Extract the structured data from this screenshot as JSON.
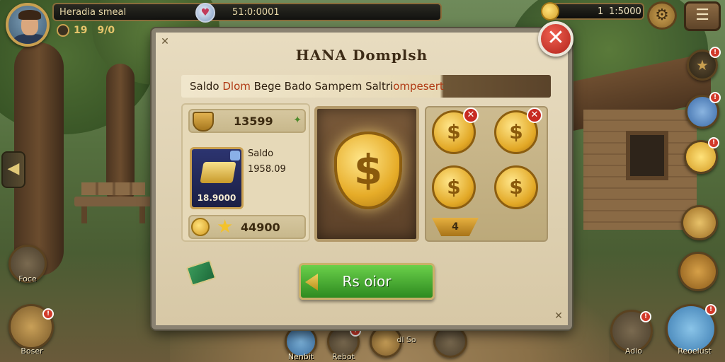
{
  "hud": {
    "player_name": "Heradia smeal",
    "top_value": "51:0:0001",
    "level": "19",
    "level_sub": "9/0",
    "coin_count": "1",
    "coin_total": "1:5000"
  },
  "dialog": {
    "title": "HANA Domplsh",
    "subtitle_a": "Saldo ",
    "subtitle_b": "Dlom",
    "subtitle_c": " Bege Bado Sampem Saltri",
    "subtitle_d": "ompesert",
    "currency_value": "13599",
    "card_price": "18.9000",
    "saldo_label": "Saldo",
    "saldo_value": "1958.09",
    "star_value": "44900",
    "dollar": "$",
    "coin_count": "4",
    "confirm_label": "Rs oior",
    "close_glyph": "✕",
    "corner_glyph": "✕"
  },
  "side": {
    "left_top_label": "Foce",
    "left_bottom_label": "Boser",
    "right_bottom_left_label": "Adio",
    "right_bottom_label": "Reoelust",
    "bottom_1_label": "Nenbit",
    "bottom_2_label": "Rebot",
    "bottom_3_label": "dl So",
    "badge": "!"
  },
  "colors": {
    "accent_gold": "#e6ac28",
    "confirm_green": "#2e8a20",
    "close_red": "#c72a22"
  }
}
